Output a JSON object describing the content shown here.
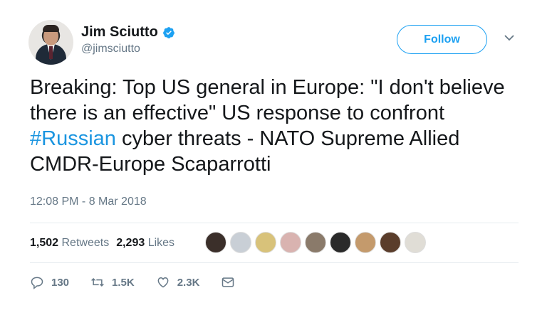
{
  "user": {
    "name": "Jim Sciutto",
    "handle": "@jimsciutto",
    "verified": true
  },
  "follow_label": "Follow",
  "tweet": {
    "text_before": "Breaking: Top US general in Europe: \"I don't believe there is an effective\" US response to confront ",
    "hashtag": "#Russian",
    "text_after": " cyber threats - NATO Supreme Allied CMDR-Europe Scaparrotti"
  },
  "timestamp": "12:08 PM - 8 Mar 2018",
  "stats": {
    "retweets_count": "1,502",
    "retweets_label": "Retweets",
    "likes_count": "2,293",
    "likes_label": "Likes"
  },
  "liker_colors": [
    "#3b2f2a",
    "#c9cfd6",
    "#d8c27a",
    "#d9b3b0",
    "#8a7a6a",
    "#2a2a2a",
    "#c49a6c",
    "#5a3d2b",
    "#e0ddd6"
  ],
  "actions": {
    "reply_count": "130",
    "retweet_count": "1.5K",
    "like_count": "2.3K"
  },
  "colors": {
    "accent": "#1da1f2",
    "hashtag": "#1b95e0",
    "secondary_text": "#657786"
  }
}
